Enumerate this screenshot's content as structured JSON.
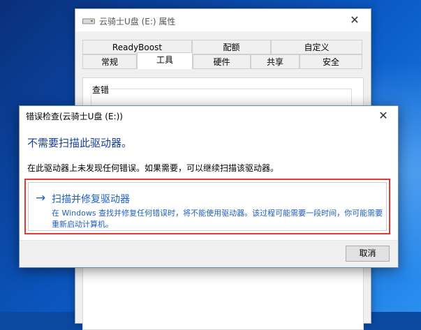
{
  "properties_window": {
    "title": "云骑士U盘 (E:) 属性",
    "close_glyph": "✕",
    "tabs_row1": [
      {
        "label": "ReadyBoost"
      },
      {
        "label": "配额"
      },
      {
        "label": "自定义"
      }
    ],
    "tabs_row2": [
      {
        "label": "常规"
      },
      {
        "label": "工具"
      },
      {
        "label": "硬件"
      },
      {
        "label": "共享"
      },
      {
        "label": "安全"
      }
    ],
    "active_tab": "工具",
    "group_label": "查错"
  },
  "dialog": {
    "title": "错误检查(云骑士U盘 (E:))",
    "close_glyph": "✕",
    "heading": "不需要扫描此驱动器。",
    "message": "在此驱动器上未发现任何错误。如果需要，可以继续扫描该驱动器。",
    "command_link": {
      "arrow": "→",
      "title": "扫描并修复驱动器",
      "description": "在 Windows 查找并修复任何错误时，将不能使用驱动器。该过程可能需要一段时间，你可能需要重新启动计算机。"
    },
    "cancel_label": "取消"
  },
  "colors": {
    "link_blue": "#1f5fc4",
    "highlight_red": "#e53935",
    "heading_blue": "#1a3f9a"
  }
}
